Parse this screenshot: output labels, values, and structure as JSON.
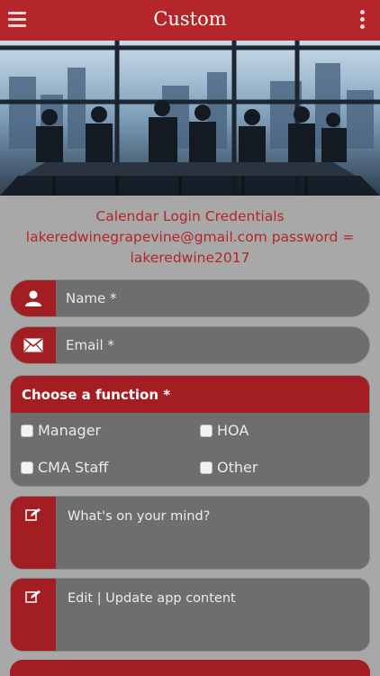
{
  "header": {
    "title": "Custom"
  },
  "credentials": {
    "line1": "Calendar Login Credentials",
    "line2": "lakeredwinegrapevine@gmail.com password =",
    "line3": "lakeredwine2017"
  },
  "form": {
    "name_placeholder": "Name *",
    "email_placeholder": "Email *",
    "function": {
      "title": "Choose a function *",
      "options": [
        "Manager",
        "HOA",
        "CMA Staff",
        "Other"
      ]
    },
    "mind_placeholder": "What's on your mind?",
    "update_placeholder": "Edit | Update app content"
  },
  "colors": {
    "accent": "#b5262b",
    "panel": "#6e6e6e",
    "background": "#a8a8a8"
  },
  "icons": [
    "menu-icon",
    "more-vert-icon",
    "person-icon",
    "envelope-icon",
    "edit-icon"
  ]
}
